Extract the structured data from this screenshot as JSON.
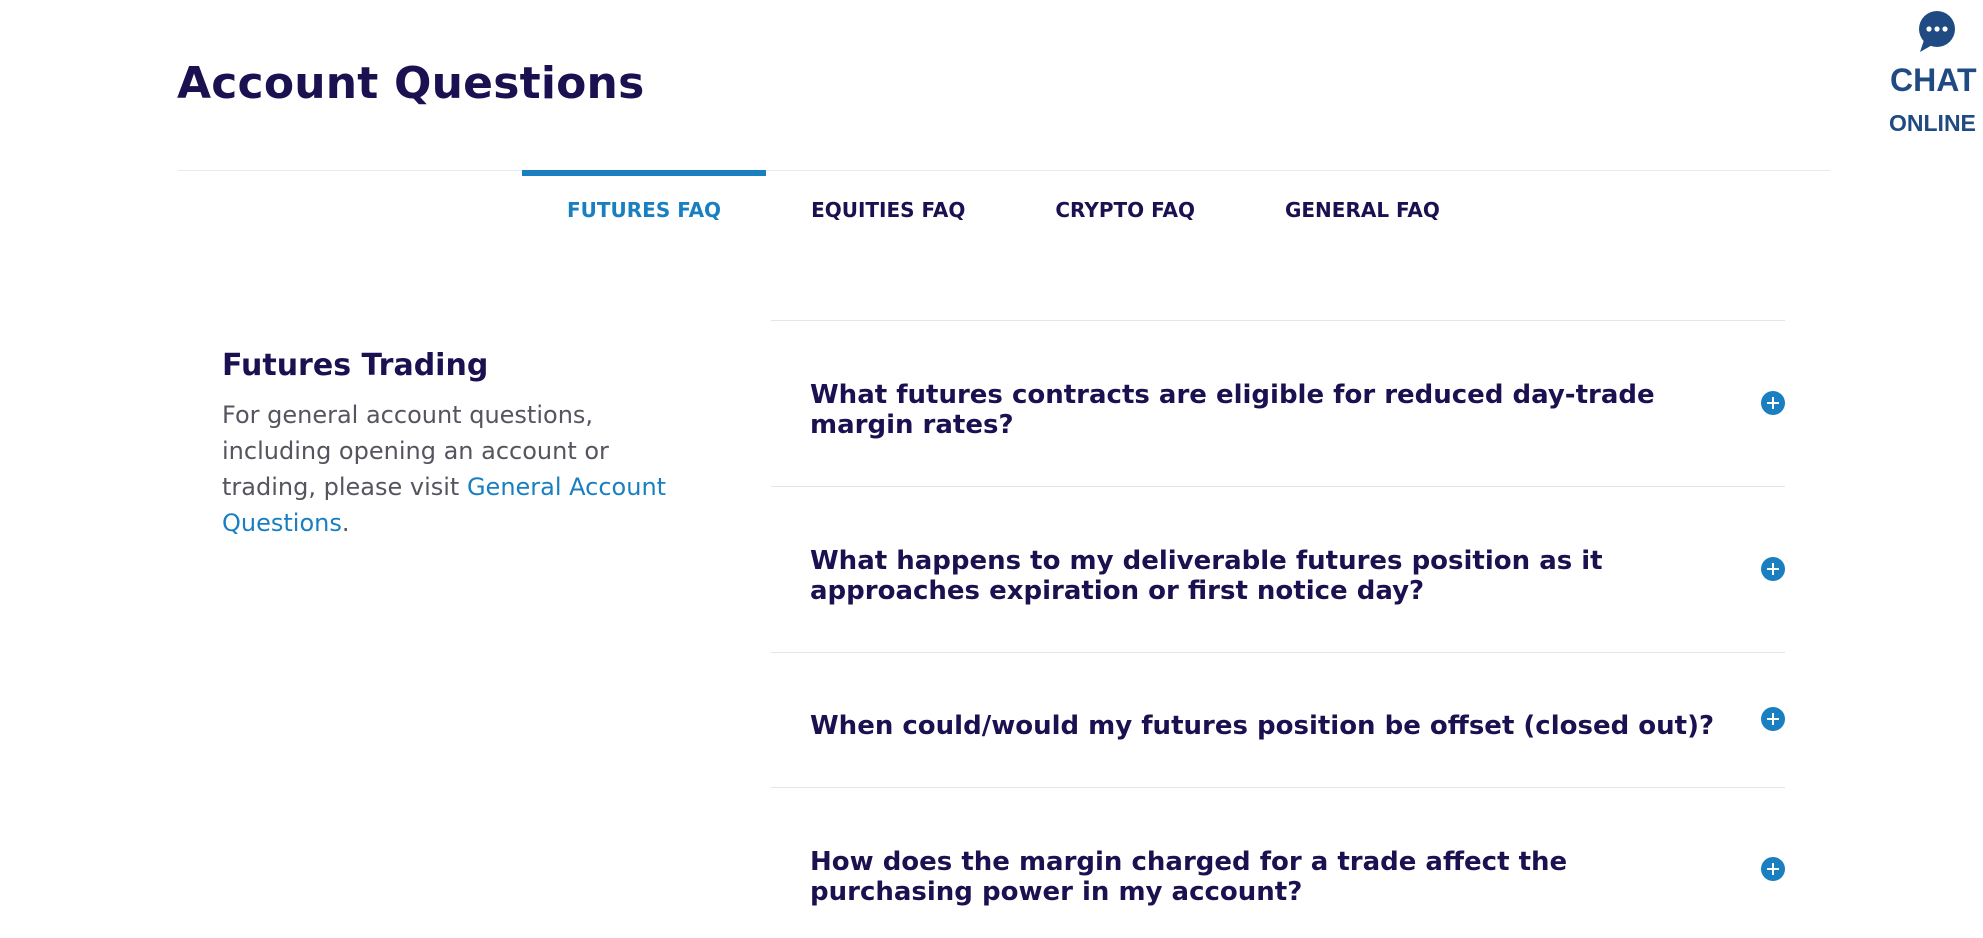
{
  "page": {
    "title": "Account Questions"
  },
  "chat": {
    "label": "CHAT",
    "sublabel": "ONLINE",
    "icon": "chat-bubble-icon"
  },
  "tabs": [
    {
      "label": "FUTURES FAQ",
      "active": true
    },
    {
      "label": "EQUITIES FAQ",
      "active": false
    },
    {
      "label": "CRYPTO FAQ",
      "active": false
    },
    {
      "label": "GENERAL FAQ",
      "active": false
    }
  ],
  "sidebar": {
    "title": "Futures Trading",
    "text_before_link": "For general account questions, including opening an account or trading, please visit ",
    "link_text": "General Account Questions",
    "text_after_link": "."
  },
  "faq": {
    "items": [
      {
        "question": "What futures contracts are eligible for reduced day-trade margin rates?"
      },
      {
        "question": "What happens to my deliverable futures position as it approaches expiration or first notice day?"
      },
      {
        "question": "When could/would my futures position be offset (closed out)?"
      },
      {
        "question": "How does the margin charged for a trade affect the purchasing power in my account?"
      }
    ]
  },
  "colors": {
    "navy": "#1b1050",
    "accent": "#1a7fc1",
    "chat_blue": "#1f4a82",
    "body_text": "#55555f"
  }
}
